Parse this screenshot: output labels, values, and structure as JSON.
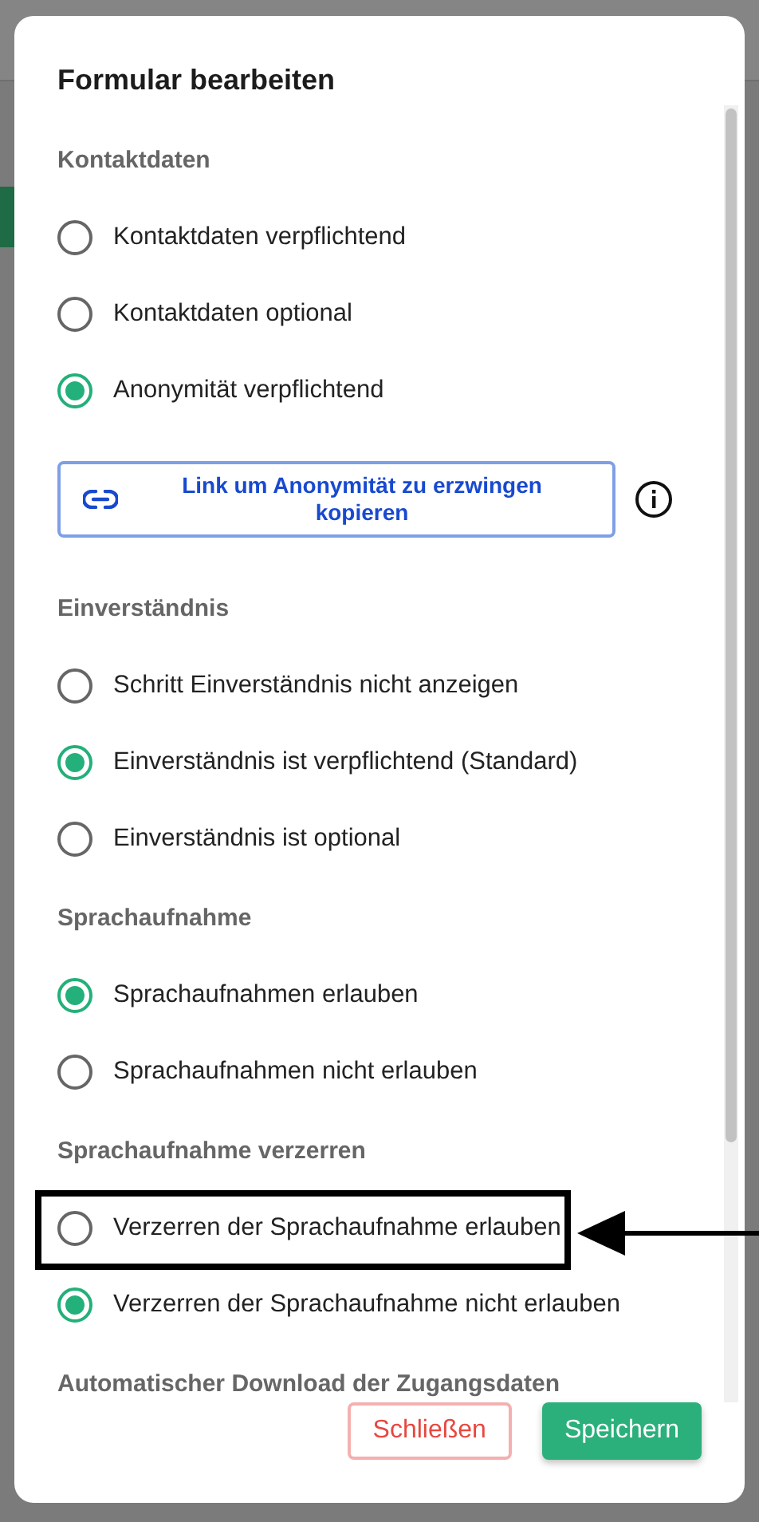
{
  "dialog": {
    "title": "Formular bearbeiten",
    "sections": [
      {
        "heading": "Kontaktdaten",
        "options": [
          {
            "label": "Kontaktdaten verpflichtend",
            "selected": false
          },
          {
            "label": "Kontaktdaten optional",
            "selected": false
          },
          {
            "label": "Anonymität verpflichtend",
            "selected": true
          }
        ],
        "link_button": {
          "label": "Link um Anonymität zu erzwingen kopieren"
        }
      },
      {
        "heading": "Einverständnis",
        "options": [
          {
            "label": "Schritt Einverständnis nicht anzeigen",
            "selected": false
          },
          {
            "label": "Einverständnis ist verpflichtend (Standard)",
            "selected": true
          },
          {
            "label": "Einverständnis ist optional",
            "selected": false
          }
        ]
      },
      {
        "heading": "Sprachaufnahme",
        "options": [
          {
            "label": "Sprachaufnahmen erlauben",
            "selected": true
          },
          {
            "label": "Sprachaufnahmen nicht erlauben",
            "selected": false
          }
        ]
      },
      {
        "heading": "Sprachaufnahme verzerren",
        "options": [
          {
            "label": "Verzerren der Sprachaufnahme erlauben",
            "selected": false,
            "highlighted": true
          },
          {
            "label": "Verzerren der Sprachaufnahme nicht erlauben",
            "selected": true,
            "highlighted": false
          }
        ]
      },
      {
        "heading": "Automatischer Download der Zugangsdaten"
      }
    ],
    "buttons": [
      {
        "label": "Schließen",
        "kind": "secondary"
      },
      {
        "label": "Speichern",
        "kind": "primary"
      }
    ]
  }
}
